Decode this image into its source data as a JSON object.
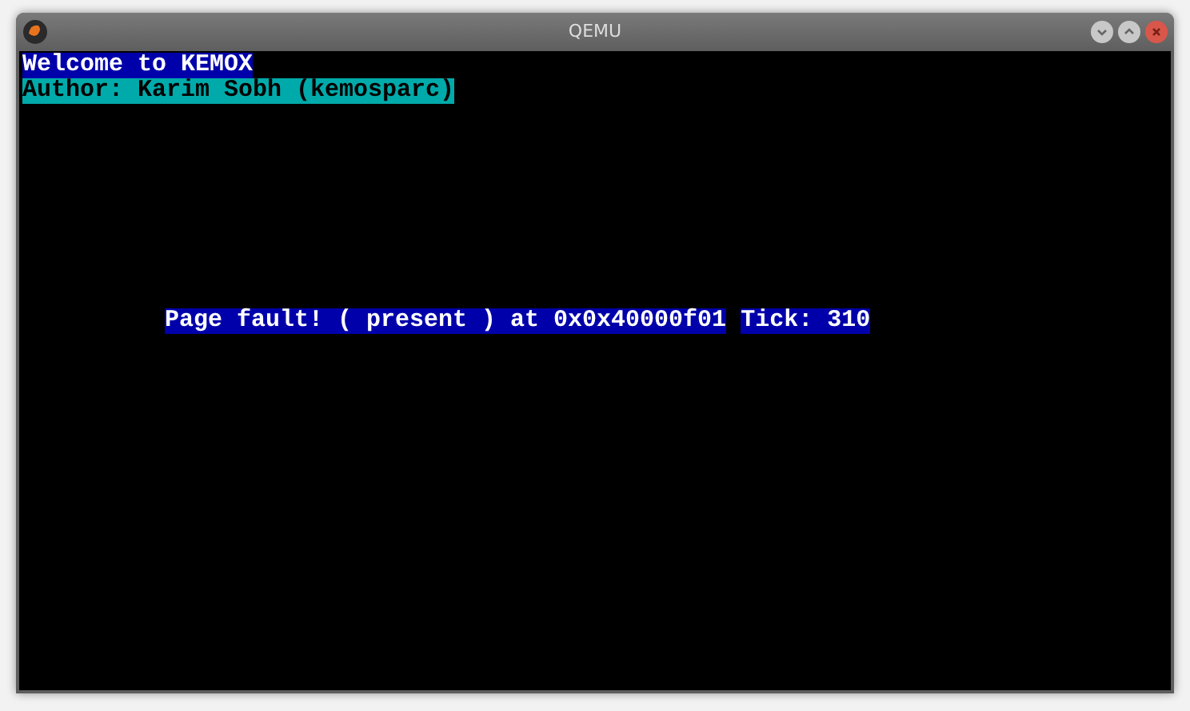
{
  "window": {
    "title": "QEMU"
  },
  "console": {
    "lines": [
      {
        "segments": [
          {
            "text": "Welcome to KEMOX",
            "color": "#0000aa"
          }
        ]
      },
      {
        "segments": [
          {
            "text": "Author: Karim Sobh (kemosparc)",
            "color": "#00aaaa"
          }
        ]
      },
      {
        "segments": [
          {
            "text": "Page fault! ( present ) at 0x0x40000f01",
            "color": "#0000aa"
          },
          {
            "text": "Tick: 310",
            "color": "#0000aa"
          }
        ]
      }
    ]
  }
}
